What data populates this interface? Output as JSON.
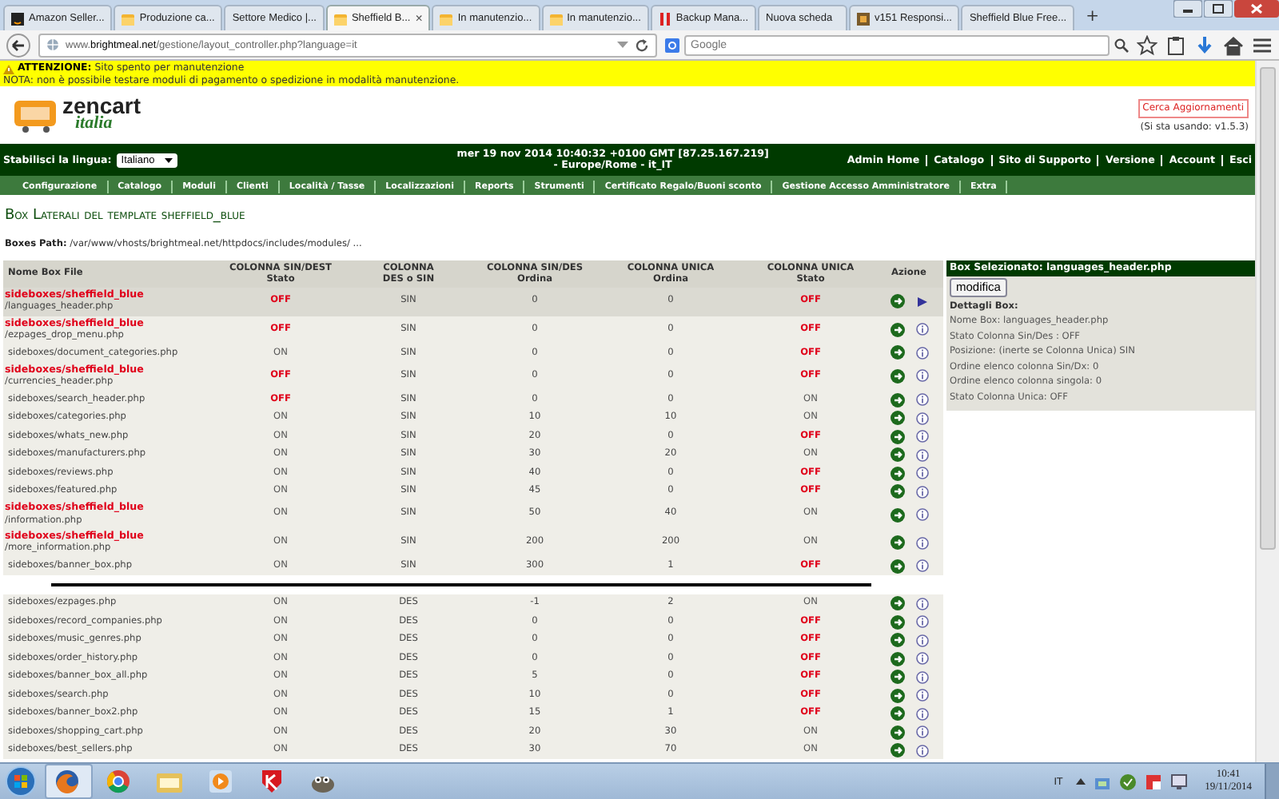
{
  "browser": {
    "tabs": [
      {
        "label": "Amazon Seller...",
        "kind": "dark-square",
        "selected": false
      },
      {
        "label": "Produzione ca...",
        "kind": "folder",
        "selected": false
      },
      {
        "label": "Settore Medico |...",
        "kind": "plain",
        "selected": false
      },
      {
        "label": "Sheffield B...",
        "kind": "folder",
        "selected": true,
        "close": "×"
      },
      {
        "label": "In manutenzio...",
        "kind": "folder",
        "selected": false
      },
      {
        "label": "In manutenzio...",
        "kind": "folder",
        "selected": false
      },
      {
        "label": "Backup Mana...",
        "kind": "red-bars",
        "selected": false
      },
      {
        "label": "Nuova scheda",
        "kind": "plain",
        "selected": false
      },
      {
        "label": "v151 Responsi...",
        "kind": "picture",
        "selected": false
      },
      {
        "label": "Sheffield Blue Free...",
        "kind": "plain",
        "selected": false
      }
    ],
    "new_tab": "+",
    "url": "www.**brightmeal.net**/gestione/layout_controller.php?language=it",
    "search": {
      "placeholder": "Google"
    }
  },
  "notice": {
    "lines": [
      "**ATTENZIONE:** Sito spento per manutenzione",
      "NOTA: non è possibile testare moduli di pagamento o spedizione in modalità manutenzione."
    ]
  },
  "header": {
    "logo": {
      "brand": "zencart",
      "tagline": "italia"
    },
    "update_button": "Cerca Aggiornamenti",
    "version": "(Si sta usando: v1.5.3)"
  },
  "topbar": {
    "language_label": "Stabilisci la lingua:",
    "language": "Italiano",
    "datetime": [
      "mer 19 nov 2014 10:40:32 +0100 GMT [87.25.167.219]",
      "- Europe/Rome - it_IT"
    ],
    "links": [
      "Admin Home",
      "Catalogo",
      "Sito di Supporto",
      "Versione",
      "Account",
      "Esci"
    ]
  },
  "menu": [
    "Configurazione",
    "Catalogo",
    "Moduli",
    "Clienti",
    "Località / Tasse",
    "Localizzazioni",
    "Reports",
    "Strumenti",
    "Certificato Regalo/Buoni sconto",
    "Gestione Accesso Amministratore",
    "Extra"
  ],
  "page": {
    "title": "Box Laterali del template sheffield_blue",
    "path": "**Boxes Path:** /var/www/vhosts/brightmeal.net/httpdocs/includes/modules/ ..."
  },
  "table": {
    "columns": [
      {
        "title": "Nome Box File"
      },
      {
        "title": "COLONNA SIN/DEST",
        "subtitle": "Stato"
      },
      {
        "title": "COLONNA",
        "subtitle": "DES o SIN"
      },
      {
        "title": "COLONNA SIN/DES",
        "subtitle": "Ordina"
      },
      {
        "title": "COLONNA UNICA",
        "subtitle": "Ordina"
      },
      {
        "title": "COLONNA UNICA",
        "subtitle": "Stato"
      },
      {
        "title": "Azione"
      }
    ],
    "sections": [
      {
        "rows": [
          {
            "file": "**sideboxes/sheffield_blue**\n/languages_header.php",
            "status": {
              "text": "OFF",
              "on": false
            },
            "side": "SIN",
            "order": "0",
            "single_order": "0",
            "single_status": {
              "text": "OFF",
              "on": false
            },
            "selected": true
          },
          {
            "file": "**sideboxes/sheffield_blue**\n/ezpages_drop_menu.php",
            "status": {
              "text": "OFF",
              "on": false
            },
            "side": "SIN",
            "order": "0",
            "single_order": "0",
            "single_status": {
              "text": "OFF",
              "on": false
            },
            "selected": false
          },
          {
            "file": "sideboxes/document_categories.php",
            "status": {
              "text": "ON",
              "on": true
            },
            "side": "SIN",
            "order": "0",
            "single_order": "0",
            "single_status": {
              "text": "OFF",
              "on": false
            },
            "selected": false
          },
          {
            "file": "**sideboxes/sheffield_blue**\n/currencies_header.php",
            "status": {
              "text": "OFF",
              "on": false
            },
            "side": "SIN",
            "order": "0",
            "single_order": "0",
            "single_status": {
              "text": "OFF",
              "on": false
            },
            "selected": false
          },
          {
            "file": "sideboxes/search_header.php",
            "status": {
              "text": "OFF",
              "on": false
            },
            "side": "SIN",
            "order": "0",
            "single_order": "0",
            "single_status": {
              "text": "ON",
              "on": true
            },
            "selected": false
          },
          {
            "file": "sideboxes/categories.php",
            "status": {
              "text": "ON",
              "on": true
            },
            "side": "SIN",
            "order": "10",
            "single_order": "10",
            "single_status": {
              "text": "ON",
              "on": true
            },
            "selected": false
          },
          {
            "file": "sideboxes/whats_new.php",
            "status": {
              "text": "ON",
              "on": true
            },
            "side": "SIN",
            "order": "20",
            "single_order": "0",
            "single_status": {
              "text": "OFF",
              "on": false
            },
            "selected": false
          },
          {
            "file": "sideboxes/manufacturers.php",
            "status": {
              "text": "ON",
              "on": true
            },
            "side": "SIN",
            "order": "30",
            "single_order": "20",
            "single_status": {
              "text": "ON",
              "on": true
            },
            "selected": false
          },
          {
            "file": "sideboxes/reviews.php",
            "status": {
              "text": "ON",
              "on": true
            },
            "side": "SIN",
            "order": "40",
            "single_order": "0",
            "single_status": {
              "text": "OFF",
              "on": false
            },
            "selected": false
          },
          {
            "file": "sideboxes/featured.php",
            "status": {
              "text": "ON",
              "on": true
            },
            "side": "SIN",
            "order": "45",
            "single_order": "0",
            "single_status": {
              "text": "OFF",
              "on": false
            },
            "selected": false
          },
          {
            "file": "**sideboxes/sheffield_blue**\n/information.php",
            "status": {
              "text": "ON",
              "on": true
            },
            "side": "SIN",
            "order": "50",
            "single_order": "40",
            "single_status": {
              "text": "ON",
              "on": true
            },
            "selected": false
          },
          {
            "file": "**sideboxes/sheffield_blue**\n/more_information.php",
            "status": {
              "text": "ON",
              "on": true
            },
            "side": "SIN",
            "order": "200",
            "single_order": "200",
            "single_status": {
              "text": "ON",
              "on": true
            },
            "selected": false
          },
          {
            "file": "sideboxes/banner_box.php",
            "status": {
              "text": "ON",
              "on": true
            },
            "side": "SIN",
            "order": "300",
            "single_order": "1",
            "single_status": {
              "text": "OFF",
              "on": false
            },
            "selected": false
          }
        ]
      },
      {
        "rows": [
          {
            "file": "sideboxes/ezpages.php",
            "status": {
              "text": "ON",
              "on": true
            },
            "side": "DES",
            "order": "-1",
            "single_order": "2",
            "single_status": {
              "text": "ON",
              "on": true
            },
            "selected": false
          },
          {
            "file": "sideboxes/record_companies.php",
            "status": {
              "text": "ON",
              "on": true
            },
            "side": "DES",
            "order": "0",
            "single_order": "0",
            "single_status": {
              "text": "OFF",
              "on": false
            },
            "selected": false
          },
          {
            "file": "sideboxes/music_genres.php",
            "status": {
              "text": "ON",
              "on": true
            },
            "side": "DES",
            "order": "0",
            "single_order": "0",
            "single_status": {
              "text": "OFF",
              "on": false
            },
            "selected": false
          },
          {
            "file": "sideboxes/order_history.php",
            "status": {
              "text": "ON",
              "on": true
            },
            "side": "DES",
            "order": "0",
            "single_order": "0",
            "single_status": {
              "text": "OFF",
              "on": false
            },
            "selected": false
          },
          {
            "file": "sideboxes/banner_box_all.php",
            "status": {
              "text": "ON",
              "on": true
            },
            "side": "DES",
            "order": "5",
            "single_order": "0",
            "single_status": {
              "text": "OFF",
              "on": false
            },
            "selected": false
          },
          {
            "file": "sideboxes/search.php",
            "status": {
              "text": "ON",
              "on": true
            },
            "side": "DES",
            "order": "10",
            "single_order": "0",
            "single_status": {
              "text": "OFF",
              "on": false
            },
            "selected": false
          },
          {
            "file": "sideboxes/banner_box2.php",
            "status": {
              "text": "ON",
              "on": true
            },
            "side": "DES",
            "order": "15",
            "single_order": "1",
            "single_status": {
              "text": "OFF",
              "on": false
            },
            "selected": false
          },
          {
            "file": "sideboxes/shopping_cart.php",
            "status": {
              "text": "ON",
              "on": true
            },
            "side": "DES",
            "order": "20",
            "single_order": "30",
            "single_status": {
              "text": "ON",
              "on": true
            },
            "selected": false
          },
          {
            "file": "sideboxes/best_sellers.php",
            "status": {
              "text": "ON",
              "on": true
            },
            "side": "DES",
            "order": "30",
            "single_order": "70",
            "single_status": {
              "text": "ON",
              "on": true
            },
            "selected": false
          }
        ]
      }
    ]
  },
  "panel": {
    "title": "Box Selezionato: languages_header.php",
    "button": "modifica",
    "heading": "Dettagli Box:",
    "details": [
      "Nome Box: languages_header.php",
      "Stato Colonna Sin/Des : OFF",
      "Posizione: (inerte se Colonna Unica) SIN",
      "Ordine elenco colonna Sin/Dx: 0",
      "Ordine elenco colonna singola: 0",
      "Stato Colonna Unica: OFF"
    ]
  },
  "taskbar": {
    "apps": [
      {
        "kind": "fox",
        "selected": true
      },
      {
        "kind": "round-browser",
        "selected": false
      },
      {
        "kind": "folder",
        "selected": false
      },
      {
        "kind": "play",
        "selected": false
      },
      {
        "kind": "shield",
        "selected": false
      },
      {
        "kind": "mascot",
        "selected": false
      }
    ],
    "language": "IT",
    "time": "10:41",
    "date": "19/11/2014"
  }
}
